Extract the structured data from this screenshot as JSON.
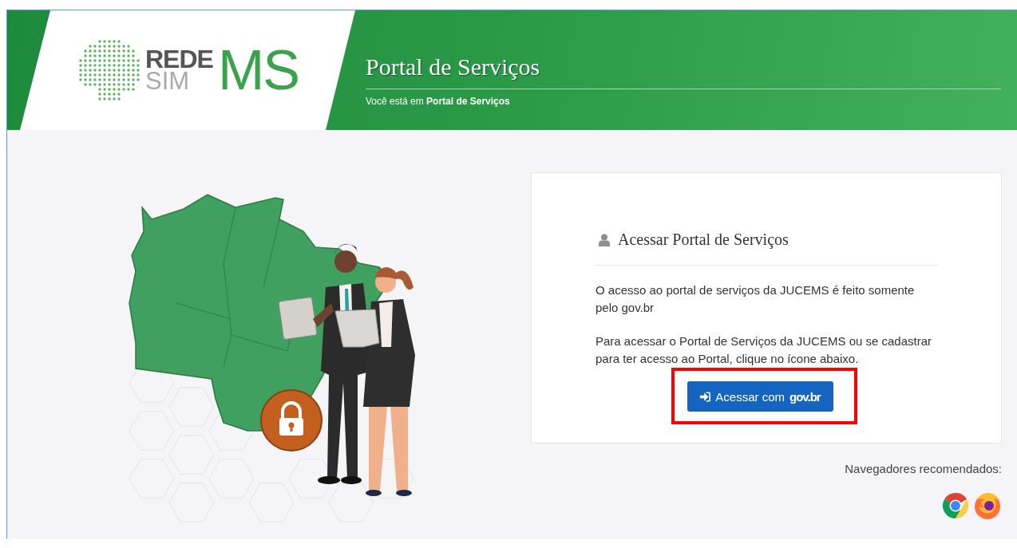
{
  "header": {
    "logo": {
      "line1": "REDE",
      "line2": "SIM",
      "mark": "MS"
    },
    "title": "Portal de Serviços",
    "breadcrumb": {
      "prefix": "Você está em",
      "current": "Portal de Serviços"
    }
  },
  "login_card": {
    "heading": "Acessar Portal de Serviços",
    "paragraphs": [
      "O acesso ao portal de serviços da JUCEMS é feito somente pelo gov.br",
      "Para acessar o Portal de Serviços da JUCEMS ou se cadastrar para ter acesso ao Portal, clique no ícone abaixo."
    ],
    "button": {
      "label": "Acessar com",
      "brand": "gov.br",
      "highlighted": true
    }
  },
  "browsers": {
    "label": "Navegadores recomendados:",
    "items": [
      {
        "kind": "chrome"
      },
      {
        "kind": "firefox"
      }
    ]
  }
}
